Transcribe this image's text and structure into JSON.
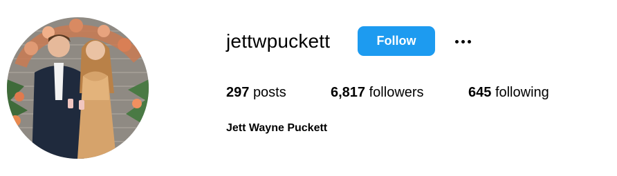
{
  "profile": {
    "username": "jettwpuckett",
    "full_name": "Jett Wayne Puckett",
    "follow_label": "Follow",
    "more_icon": "more-horizontal-icon",
    "accent_color": "#1d9bf0"
  },
  "stats": {
    "posts_count": "297",
    "posts_label": "posts",
    "followers_count": "6,817",
    "followers_label": "followers",
    "following_count": "645",
    "following_label": "following"
  }
}
